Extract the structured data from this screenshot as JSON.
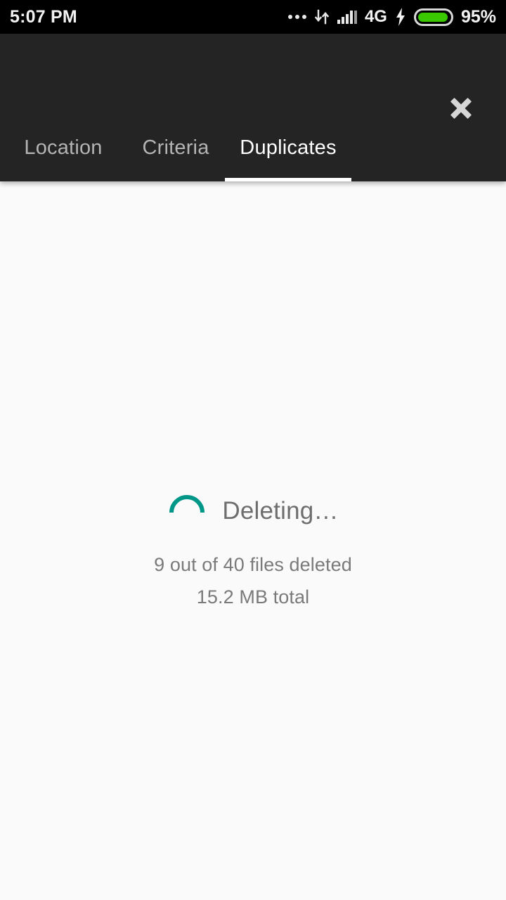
{
  "status_bar": {
    "time": "5:07 PM",
    "network_type": "4G",
    "battery_percent": "95%",
    "battery_level": 95,
    "notification_dots_icon": "more-notifications-icon",
    "data_transfer_icon": "data-transfer-arrows-icon",
    "signal_icon": "signal-bars-icon",
    "charging_icon": "charging-bolt-icon",
    "battery_icon": "battery-icon",
    "colors": {
      "background": "#000000",
      "text": "#f2f2f2",
      "battery_fill": "#3ac800"
    }
  },
  "header": {
    "close_label": "Close",
    "close_icon": "close-x-icon",
    "background": "#242424",
    "tabs": [
      {
        "id": "location",
        "label": "Location",
        "active": false
      },
      {
        "id": "criteria",
        "label": "Criteria",
        "active": false
      },
      {
        "id": "duplicates",
        "label": "Duplicates",
        "active": true
      }
    ],
    "active_tab": "Duplicates",
    "indicator_color": "#ffffff"
  },
  "content": {
    "background": "#fafafa",
    "spinner_icon": "loading-spinner-icon",
    "spinner_color": "#009688",
    "progress_title": "Deleting…",
    "progress_count": "9 out of 40 files deleted",
    "progress_size": "15.2 MB total",
    "deleted_files": 9,
    "total_files": 40,
    "total_size": "15.2 MB"
  }
}
